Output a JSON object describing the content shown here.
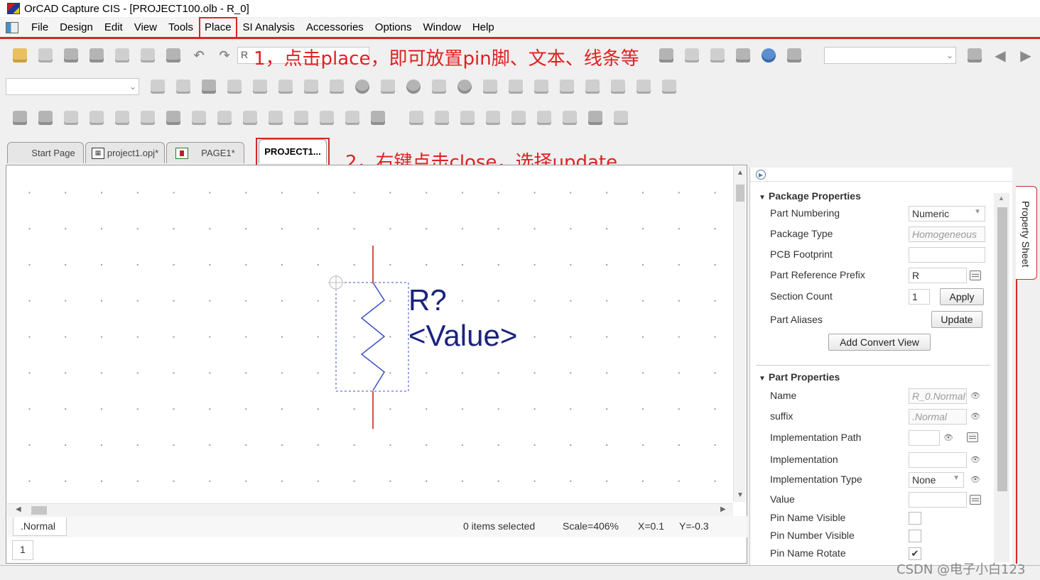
{
  "window": {
    "title": "OrCAD Capture CIS - [PROJECT100.olb - R_0]"
  },
  "menu": [
    "File",
    "Design",
    "Edit",
    "View",
    "Tools",
    "Place",
    "SI Analysis",
    "Accessories",
    "Options",
    "Window",
    "Help"
  ],
  "toolbar": {
    "ref_combo_value": "R"
  },
  "annotations": {
    "step1": "1，点击place，即可放置pin脚、文本、线条等",
    "step2": "2，右键点击close，选择update"
  },
  "tabs": [
    {
      "label": "Start Page"
    },
    {
      "label": "project1.opj*"
    },
    {
      "label": "PAGE1*"
    },
    {
      "label": "PROJECT1..."
    }
  ],
  "symbol": {
    "ref": "R?",
    "value": "<Value>"
  },
  "status": {
    "view": ".Normal",
    "selected": "0 items selected",
    "scale": "Scale=406%",
    "x": "X=0.1",
    "y": "Y=-0.3",
    "page": "1"
  },
  "package_properties": {
    "header": "Package Properties",
    "part_numbering_label": "Part Numbering",
    "part_numbering_value": "Numeric",
    "package_type_label": "Package Type",
    "package_type_value": "Homogeneous",
    "pcb_footprint_label": "PCB Footprint",
    "pcb_footprint_value": "",
    "ref_prefix_label": "Part Reference Prefix",
    "ref_prefix_value": "R",
    "section_count_label": "Section Count",
    "section_count_value": "1",
    "apply_label": "Apply",
    "part_aliases_label": "Part Aliases",
    "update_label": "Update",
    "add_convert_label": "Add Convert View"
  },
  "part_properties": {
    "header": "Part Properties",
    "name_label": "Name",
    "name_value": "R_0.Normal",
    "suffix_label": "suffix",
    "suffix_value": ".Normal",
    "impl_path_label": "Implementation Path",
    "impl_label": "Implementation",
    "impl_type_label": "Implementation Type",
    "impl_type_value": "None",
    "value_label": "Value",
    "pin_name_visible_label": "Pin Name Visible",
    "pin_number_visible_label": "Pin Number Visible",
    "pin_name_rotate_label": "Pin Name Rotate",
    "pin_name_rotate_checked": true
  },
  "side_tab": "Property Sheet",
  "watermark": "CSDN @电子小白123",
  "colors": {
    "annotation_red": "#d12a2a",
    "symbol_blue": "#1a237e",
    "pin_red": "#cc1111"
  }
}
